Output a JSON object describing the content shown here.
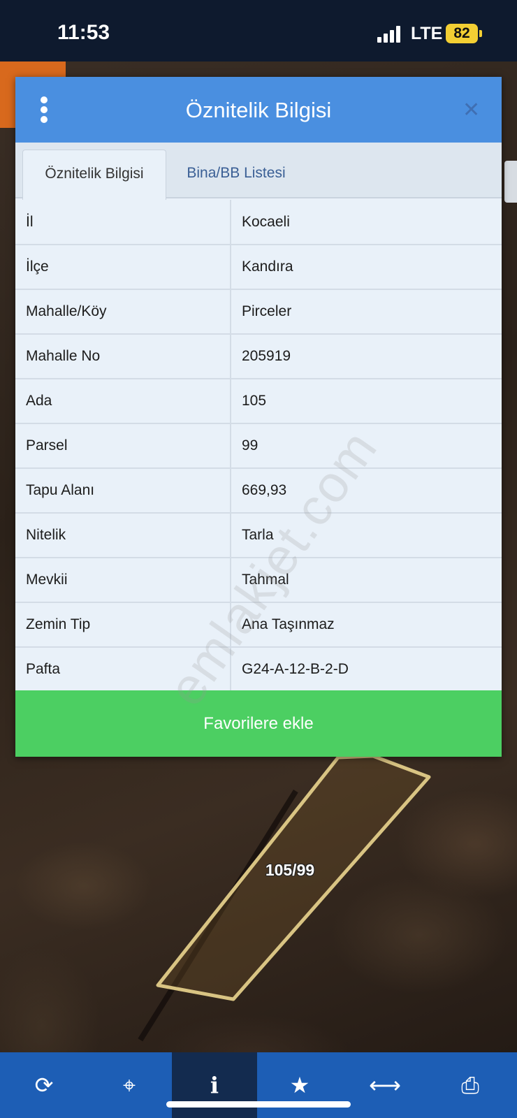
{
  "status_bar": {
    "time": "11:53",
    "network": "LTE",
    "battery": "82"
  },
  "dialog": {
    "title": "Öznitelik Bilgisi",
    "tabs": [
      {
        "label": "Öznitelik Bilgisi",
        "active": true
      },
      {
        "label": "Bina/BB Listesi",
        "active": false
      }
    ],
    "rows": [
      {
        "key": "İl",
        "value": "Kocaeli"
      },
      {
        "key": "İlçe",
        "value": "Kandıra"
      },
      {
        "key": "Mahalle/Köy",
        "value": "Pirceler"
      },
      {
        "key": "Mahalle No",
        "value": "205919"
      },
      {
        "key": "Ada",
        "value": "105"
      },
      {
        "key": "Parsel",
        "value": "99"
      },
      {
        "key": "Tapu Alanı",
        "value": "669,93"
      },
      {
        "key": "Nitelik",
        "value": "Tarla"
      },
      {
        "key": "Mevkii",
        "value": "Tahmal"
      },
      {
        "key": "Zemin Tip",
        "value": "Ana Taşınmaz"
      },
      {
        "key": "Pafta",
        "value": "G24-A-12-B-2-D"
      }
    ],
    "favorite_button": "Favorilere ekle"
  },
  "map": {
    "parcel_label": "105/99"
  },
  "watermark": "emlakjet.com",
  "toolbar": {
    "items": [
      {
        "name": "refresh-icon",
        "glyph": "⟳"
      },
      {
        "name": "locate-icon",
        "glyph": "⌖"
      },
      {
        "name": "info-icon",
        "glyph": "i",
        "active": true
      },
      {
        "name": "star-icon",
        "glyph": "★"
      },
      {
        "name": "measure-icon",
        "glyph": "⟷"
      },
      {
        "name": "print-icon",
        "glyph": "⎙"
      }
    ]
  },
  "colors": {
    "header": "#4a8fe0",
    "favorite": "#4ccf62",
    "toolbar": "#1d5eb5",
    "toolbar_active": "#132b4f",
    "parcel_outline": "#d9c483"
  }
}
